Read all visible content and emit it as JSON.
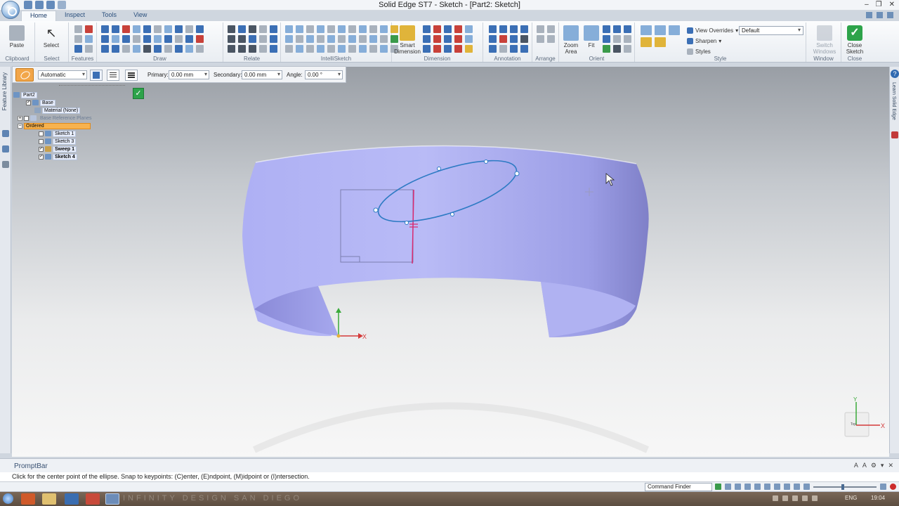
{
  "window": {
    "title": "Solid Edge ST7 - Sketch - [Part2: Sketch]"
  },
  "tabs": [
    "Home",
    "Inspect",
    "Tools",
    "View"
  ],
  "ribbon": {
    "groups": {
      "clipboard": "Clipboard",
      "select": "Select",
      "features": "Features",
      "draw": "Draw",
      "relate": "Relate",
      "intellisketch": "IntelliSketch",
      "dimension": "Dimension",
      "annotation": "Annotation",
      "arrange": "Arrange",
      "orient": "Orient",
      "style": "Style",
      "window": "Window",
      "close": "Close"
    },
    "paste": "Paste",
    "select_btn": "Select",
    "smart_dimension": [
      "Smart",
      "Dimension"
    ],
    "zoom_area": [
      "Zoom",
      "Area"
    ],
    "fit": "Fit",
    "view_overrides": "View Overrides",
    "sharpen": "Sharpen",
    "styles": "Styles",
    "style_value": "Default",
    "switch_windows": [
      "Switch",
      "Windows"
    ],
    "close_sketch": [
      "Close",
      "Sketch"
    ]
  },
  "command_bar": {
    "mode": "Automatic",
    "primary_label": "Primary:",
    "primary_value": "0.00 mm",
    "secondary_label": "Secondary:",
    "secondary_value": "0.00 mm",
    "angle_label": "Angle:",
    "angle_value": "0.00 °"
  },
  "side_tabs": {
    "left": "Feature Library",
    "right": "Learn Solid Edge"
  },
  "tree": {
    "root": "Part2",
    "items": [
      {
        "label": "Base",
        "checked": true
      },
      {
        "label": "Material (None)",
        "checked": false
      },
      {
        "label": "Base Reference Planes",
        "checked": false
      },
      {
        "label": "Ordered",
        "checked": false
      },
      {
        "label": "Sketch 1",
        "checked": false
      },
      {
        "label": "Sketch 3",
        "checked": false
      },
      {
        "label": "Sweep 1",
        "checked": true
      },
      {
        "label": "Sketch 4",
        "checked": true
      }
    ]
  },
  "triad": {
    "y": "Y",
    "x": "X",
    "view_cube_label": "Top"
  },
  "prompt_bar": {
    "title": "PromptBar",
    "text": "Click for the center point of the ellipse.  Snap to keypoints: (C)enter, (E)ndpoint, (M)idpoint or (I)ntersection."
  },
  "status_bar": {
    "command_finder": "Command Finder"
  },
  "taskbar": {
    "watermark": "INFINITY DESIGN SAN DIEGO",
    "language": "ENG",
    "clock": "19:04"
  },
  "colors": {
    "part_fill": "#a8a8f0",
    "sketch_line": "#2e7bc4",
    "accent_orange": "#f7b24e",
    "accept_green": "#2da34a"
  }
}
